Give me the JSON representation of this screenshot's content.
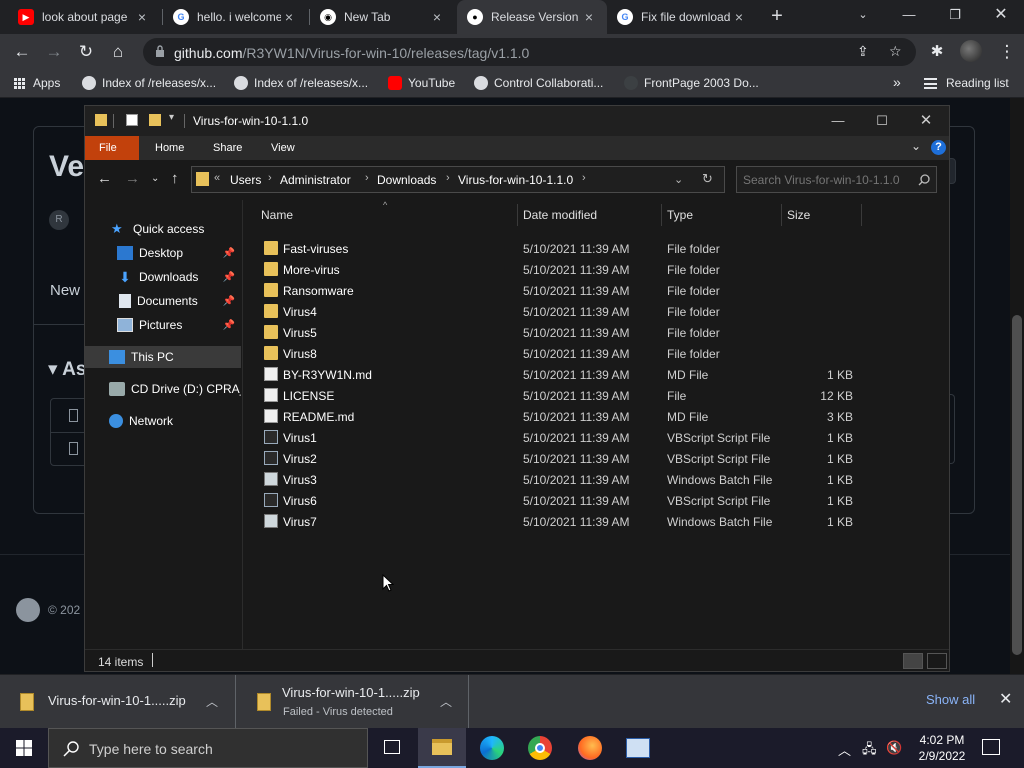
{
  "browser": {
    "tabs": [
      {
        "title": "look about page",
        "favicon": "youtube-icon"
      },
      {
        "title": "hello. i welcome",
        "favicon": "google-icon"
      },
      {
        "title": "New Tab",
        "favicon": "chrome-icon"
      },
      {
        "title": "Release Version",
        "favicon": "github-icon",
        "active": true
      },
      {
        "title": "Fix file download",
        "favicon": "google-icon"
      }
    ],
    "url_host": "github.com",
    "url_path": "/R3YW1N/Virus-for-win-10/releases/tag/v1.1.0",
    "bookmarks": [
      {
        "label": "Apps"
      },
      {
        "label": "Index of /releases/x..."
      },
      {
        "label": "Index of /releases/x..."
      },
      {
        "label": "YouTube"
      },
      {
        "label": "Control Collaborati..."
      },
      {
        "label": "FrontPage 2003 Do..."
      }
    ],
    "bookmarks_overflow": "»",
    "reading_list": "Reading list"
  },
  "github_page": {
    "heading_fragment": "Ve",
    "author_fragment": "R",
    "new_fragment": "New",
    "assets_fragment": "As",
    "footer_fragment": "© 202"
  },
  "explorer": {
    "title": "Virus-for-win-10-1.1.0",
    "ribbon_tabs": [
      "File",
      "Home",
      "Share",
      "View"
    ],
    "breadcrumb": [
      "Users",
      "Administrator",
      "Downloads",
      "Virus-for-win-10-1.1.0"
    ],
    "breadcrumb_overflow": "«",
    "search_placeholder": "Search Virus-for-win-10-1.1.0",
    "nav_items": [
      {
        "label": "Quick access",
        "icon": "star-icon"
      },
      {
        "label": "Desktop",
        "icon": "desktop-icon",
        "pinned": true
      },
      {
        "label": "Downloads",
        "icon": "download-icon",
        "pinned": true
      },
      {
        "label": "Documents",
        "icon": "documents-icon",
        "pinned": true
      },
      {
        "label": "Pictures",
        "icon": "pictures-icon",
        "pinned": true
      },
      {
        "label": "This PC",
        "icon": "computer-icon",
        "selected": true
      },
      {
        "label": "CD Drive (D:) CPRA_X",
        "icon": "cd-drive-icon"
      },
      {
        "label": "Network",
        "icon": "network-icon"
      }
    ],
    "columns": [
      "Name",
      "Date modified",
      "Type",
      "Size"
    ],
    "files": [
      {
        "name": "Fast-viruses",
        "date": "5/10/2021 11:39 AM",
        "type": "File folder",
        "size": "",
        "kind": "folder"
      },
      {
        "name": "More-virus",
        "date": "5/10/2021 11:39 AM",
        "type": "File folder",
        "size": "",
        "kind": "folder"
      },
      {
        "name": "Ransomware",
        "date": "5/10/2021 11:39 AM",
        "type": "File folder",
        "size": "",
        "kind": "folder"
      },
      {
        "name": "Virus4",
        "date": "5/10/2021 11:39 AM",
        "type": "File folder",
        "size": "",
        "kind": "folder"
      },
      {
        "name": "Virus5",
        "date": "5/10/2021 11:39 AM",
        "type": "File folder",
        "size": "",
        "kind": "folder"
      },
      {
        "name": "Virus8",
        "date": "5/10/2021 11:39 AM",
        "type": "File folder",
        "size": "",
        "kind": "folder"
      },
      {
        "name": "BY-R3YW1N.md",
        "date": "5/10/2021 11:39 AM",
        "type": "MD File",
        "size": "1 KB",
        "kind": "doc"
      },
      {
        "name": "LICENSE",
        "date": "5/10/2021 11:39 AM",
        "type": "File",
        "size": "12 KB",
        "kind": "doc"
      },
      {
        "name": "README.md",
        "date": "5/10/2021 11:39 AM",
        "type": "MD File",
        "size": "3 KB",
        "kind": "doc"
      },
      {
        "name": "Virus1",
        "date": "5/10/2021 11:39 AM",
        "type": "VBScript Script File",
        "size": "1 KB",
        "kind": "vbs"
      },
      {
        "name": "Virus2",
        "date": "5/10/2021 11:39 AM",
        "type": "VBScript Script File",
        "size": "1 KB",
        "kind": "vbs"
      },
      {
        "name": "Virus3",
        "date": "5/10/2021 11:39 AM",
        "type": "Windows Batch File",
        "size": "1 KB",
        "kind": "bat"
      },
      {
        "name": "Virus6",
        "date": "5/10/2021 11:39 AM",
        "type": "VBScript Script File",
        "size": "1 KB",
        "kind": "vbs"
      },
      {
        "name": "Virus7",
        "date": "5/10/2021 11:39 AM",
        "type": "Windows Batch File",
        "size": "1 KB",
        "kind": "bat"
      }
    ],
    "status_count": "14 items"
  },
  "downloads": [
    {
      "name": "Virus-for-win-10-1.....zip",
      "status": ""
    },
    {
      "name": "Virus-for-win-10-1.....zip",
      "status": "Failed - Virus detected"
    }
  ],
  "download_show_all": "Show all",
  "taskbar": {
    "search_placeholder": "Type here to search",
    "time": "4:02 PM",
    "date": "2/9/2022"
  },
  "colors": {
    "file_tab": "#c2410c",
    "folder": "#e8c15a",
    "link_blue": "#8ab4f8"
  }
}
